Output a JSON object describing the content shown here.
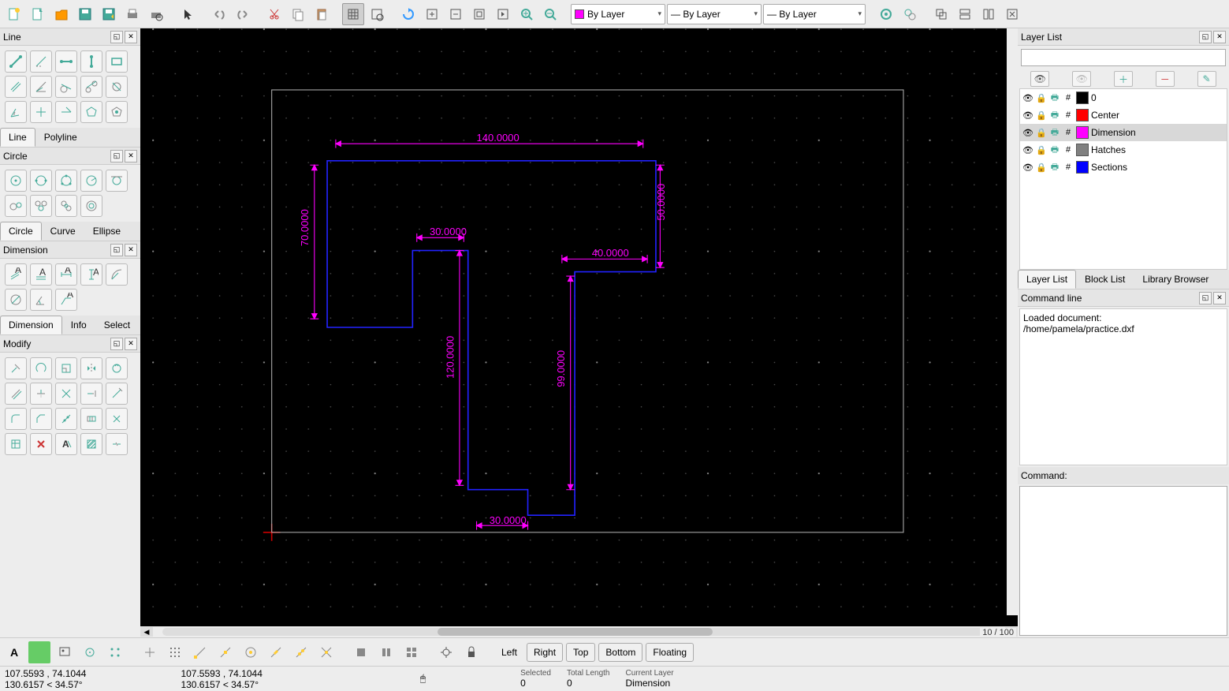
{
  "toolbar": {
    "color_combo": "By Layer",
    "width_combo": "— By Layer",
    "linetype_combo": "— By Layer"
  },
  "left": {
    "line_title": "Line",
    "circle_title": "Circle",
    "dimension_title": "Dimension",
    "modify_title": "Modify",
    "tabs1": {
      "line": "Line",
      "polyline": "Polyline"
    },
    "tabs2": {
      "circle": "Circle",
      "curve": "Curve",
      "ellipse": "Ellipse"
    },
    "tabs3": {
      "dimension": "Dimension",
      "info": "Info",
      "select": "Select"
    }
  },
  "canvas": {
    "dims": {
      "d1": "140.0000",
      "d2": "30.0000",
      "d3": "40.0000",
      "d4": "70.0000",
      "d5": "50.0000",
      "d6": "120.0000",
      "d7": "99.0000",
      "d8": "30.0000"
    },
    "zoom": "10 / 100"
  },
  "right": {
    "layer_list_title": "Layer List",
    "layers": [
      {
        "name": "0",
        "color": "#000000"
      },
      {
        "name": "Center",
        "color": "#ff0000"
      },
      {
        "name": "Dimension",
        "color": "#ff00ff"
      },
      {
        "name": "Hatches",
        "color": "#808080"
      },
      {
        "name": "Sections",
        "color": "#0000ff"
      }
    ],
    "tabs": {
      "layer": "Layer List",
      "block": "Block List",
      "library": "Library Browser"
    },
    "cmd_title": "Command line",
    "cmd_output_l1": "Loaded document:",
    "cmd_output_l2": "/home/pamela/practice.dxf",
    "cmd_label": "Command:"
  },
  "snap": {
    "left": "Left",
    "right": "Right",
    "top": "Top",
    "bottom": "Bottom",
    "floating": "Floating"
  },
  "status": {
    "abs1": "107.5593 , 74.1044",
    "rel1": "130.6157 < 34.57°",
    "abs2": "107.5593 , 74.1044",
    "rel2": "130.6157 < 34.57°",
    "selected_hdr": "Selected",
    "selected_val": "0",
    "length_hdr": "Total Length",
    "length_val": "0",
    "layer_hdr": "Current Layer",
    "layer_val": "Dimension"
  }
}
